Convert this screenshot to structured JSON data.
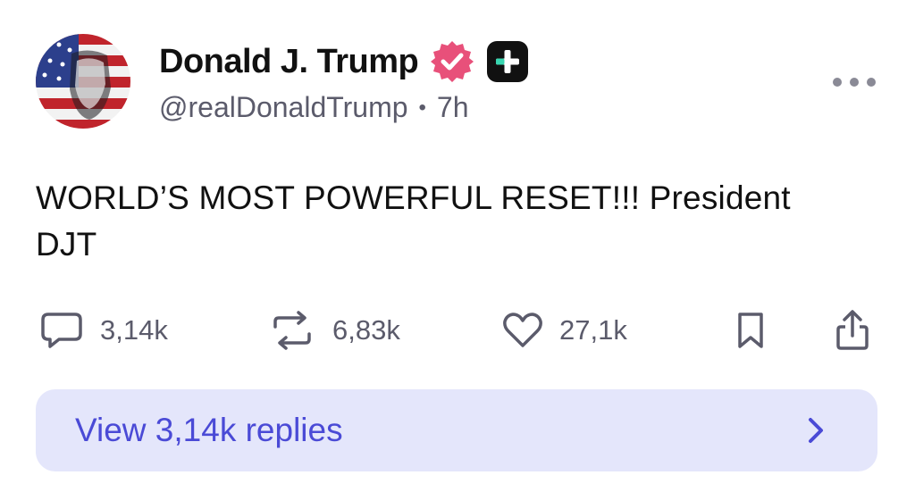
{
  "author": {
    "display_name": "Donald J. Trump",
    "handle": "@realDonaldTrump",
    "separator": "•",
    "time": "7h",
    "badges": [
      "verified-badge-icon",
      "plus-badge-icon"
    ]
  },
  "post": {
    "text_line1": "WORLD’S MOST POWERFUL RESET!!! President",
    "text_line2": "DJT"
  },
  "actions": {
    "replies": {
      "icon": "comment-icon",
      "count": "3,14k"
    },
    "reposts": {
      "icon": "repost-icon",
      "count": "6,83k"
    },
    "likes": {
      "icon": "heart-icon",
      "count": "27,1k"
    },
    "bookmark": {
      "icon": "bookmark-icon"
    },
    "share": {
      "icon": "share-icon"
    }
  },
  "replies_bar": {
    "label": "View 3,14k replies",
    "icon": "chevron-right-icon"
  },
  "colors": {
    "accent": "#4a4ad6",
    "replies_bar_bg": "#e4e6fb",
    "verified_badge": "#e8507a",
    "muted_text": "#5b5b6b"
  }
}
